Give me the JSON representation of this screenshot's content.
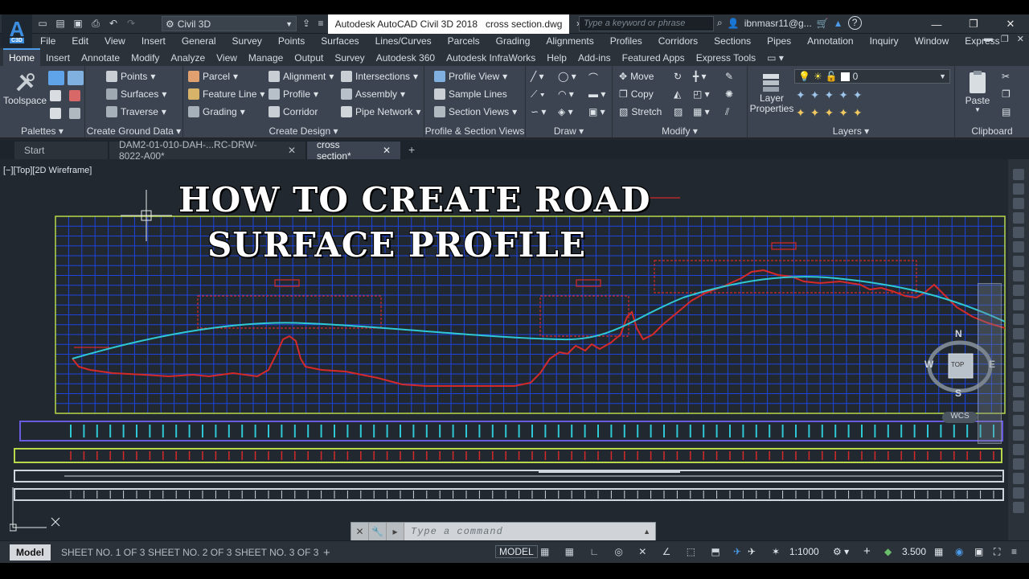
{
  "window": {
    "workspace": "Civil 3D",
    "app_title": "Autodesk AutoCAD Civil 3D 2018",
    "file_title": "cross section.dwg",
    "search_placeholder": "Type a keyword or phrase",
    "user": "ibnmasr11@g...",
    "help": "?"
  },
  "menubar": [
    "File",
    "Edit",
    "View",
    "Insert",
    "General",
    "Survey",
    "Points",
    "Surfaces",
    "Lines/Curves",
    "Parcels",
    "Grading",
    "Alignments",
    "Profiles",
    "Corridors",
    "Sections",
    "Pipes",
    "Annotation",
    "Inquiry",
    "Window",
    "Express"
  ],
  "ribbon_tabs": [
    "Home",
    "Insert",
    "Annotate",
    "Modify",
    "Analyze",
    "View",
    "Manage",
    "Output",
    "Survey",
    "Autodesk 360",
    "Autodesk InfraWorks",
    "Help",
    "Add-ins",
    "Featured Apps",
    "Express Tools"
  ],
  "ribbon": {
    "toolspace": "Toolspace",
    "palettes": "Palettes",
    "ground": {
      "points": "Points",
      "surfaces": "Surfaces",
      "traverse": "Traverse",
      "title": "Create Ground Data"
    },
    "design": {
      "parcel": "Parcel",
      "feature_line": "Feature Line",
      "grading": "Grading",
      "alignment": "Alignment",
      "profile": "Profile",
      "corridor": "Corridor",
      "intersections": "Intersections",
      "assembly": "Assembly",
      "pipe_network": "Pipe Network",
      "title": "Create Design"
    },
    "psv": {
      "profile_view": "Profile View",
      "sample_lines": "Sample Lines",
      "section_views": "Section Views",
      "title": "Profile & Section Views"
    },
    "draw_title": "Draw",
    "modify": {
      "move": "Move",
      "copy": "Copy",
      "stretch": "Stretch",
      "title": "Modify"
    },
    "layers": {
      "layer_properties": "Layer Properties",
      "current_layer": "0",
      "title": "Layers"
    },
    "clipboard": {
      "paste": "Paste",
      "title": "Clipboard"
    }
  },
  "doc_tabs": [
    "Start",
    "DAM2-01-010-DAH-...RC-DRW-8022-A00*",
    "cross section*"
  ],
  "viewport": {
    "label": "[−][Top][2D Wireframe]",
    "overlay_line1": "HOW TO CREATE ROAD",
    "overlay_line2": "SURFACE PROFILE",
    "compass": {
      "n": "N",
      "s": "S",
      "e": "E",
      "w": "W",
      "top": "TOP",
      "wcs": "WCS"
    }
  },
  "command_placeholder": "Type a command",
  "layout_tabs": [
    "Model",
    "SHEET NO. 1 OF 3",
    "SHEET NO. 2 OF 3",
    "SHEET NO. 3 OF 3"
  ],
  "status": {
    "model": "MODEL",
    "scale": "1:1000",
    "elevation": "3.500"
  },
  "colors": {
    "ground_line": "#d42a2a",
    "design_line": "#2fc9d6",
    "grid": "#1f44e0",
    "frame": "#b8d84a"
  }
}
